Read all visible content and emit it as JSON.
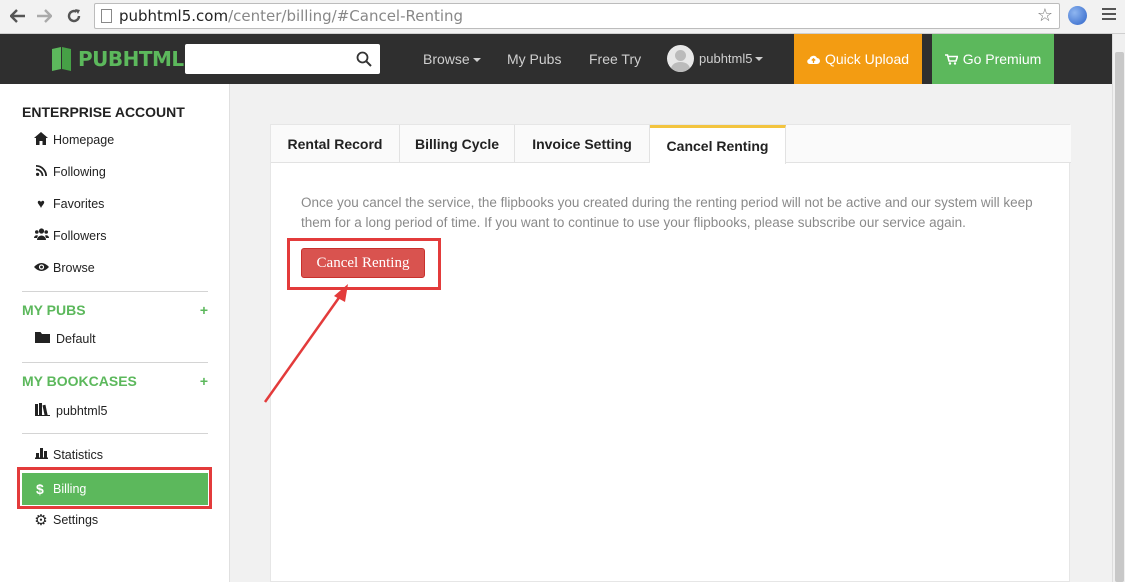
{
  "browser": {
    "url_domain": "pubhtml5.com",
    "url_path": "/center/billing/#Cancel-Renting"
  },
  "header": {
    "logo_text": "PUBHTML5",
    "search_placeholder": "",
    "nav": {
      "browse": "Browse",
      "my_pubs": "My Pubs",
      "free_try": "Free Try"
    },
    "user_name": "pubhtml5",
    "quick_upload": "Quick Upload",
    "go_premium": "Go Premium",
    "colors": {
      "bar": "#2f2f2f",
      "upload": "#f39c12",
      "premium": "#5cb85c"
    }
  },
  "sidebar": {
    "account_heading": "ENTERPRISE ACCOUNT",
    "account_items": [
      {
        "label": "Homepage",
        "icon": "home-icon"
      },
      {
        "label": "Following",
        "icon": "rss-icon"
      },
      {
        "label": "Favorites",
        "icon": "heart-icon"
      },
      {
        "label": "Followers",
        "icon": "users-icon"
      },
      {
        "label": "Browse",
        "icon": "eye-icon"
      }
    ],
    "my_pubs": {
      "heading": "MY PUBS",
      "add": "+",
      "items": [
        {
          "label": "Default",
          "icon": "folder-icon"
        }
      ]
    },
    "my_bookcases": {
      "heading": "MY BOOKCASES",
      "add": "+",
      "items": [
        {
          "label": "pubhtml5",
          "icon": "bookcase-icon"
        }
      ]
    },
    "bottom_items": [
      {
        "label": "Statistics",
        "icon": "bar-chart-icon"
      },
      {
        "label": "Billing",
        "icon": "dollar-icon",
        "active": true
      },
      {
        "label": "Settings",
        "icon": "gear-icon"
      }
    ]
  },
  "main": {
    "tabs": [
      {
        "label": "Rental Record"
      },
      {
        "label": "Billing Cycle"
      },
      {
        "label": "Invoice Setting"
      },
      {
        "label": "Cancel Renting",
        "active": true
      }
    ],
    "description": "Once you cancel the service, the flipbooks you created during the renting period will not be active and our system will keep them for a long period of time. If you want to continue to use your flipbooks, please subscribe our service again.",
    "cancel_button": "Cancel Renting"
  }
}
